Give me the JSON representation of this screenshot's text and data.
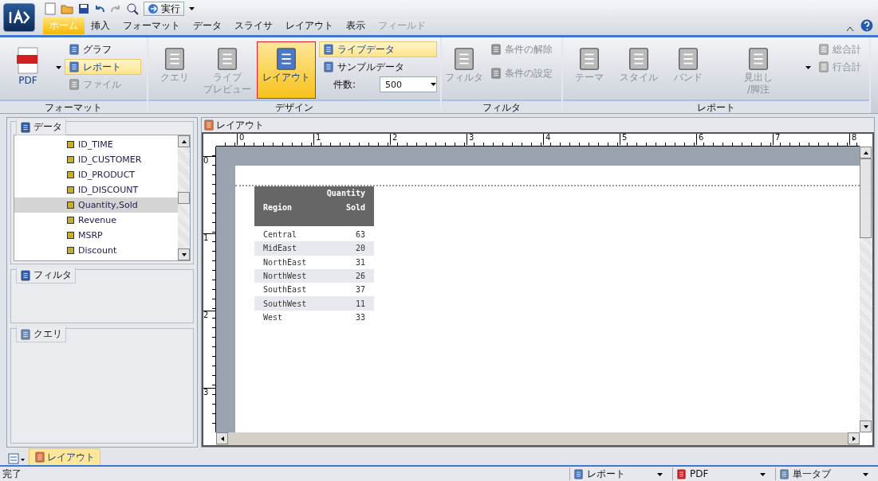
{
  "quick_access": {
    "run_label": "実行"
  },
  "menu_tabs": [
    {
      "label": "ホーム",
      "selected": true,
      "disabled": false
    },
    {
      "label": "挿入",
      "selected": false,
      "disabled": false
    },
    {
      "label": "フォーマット",
      "selected": false,
      "disabled": false
    },
    {
      "label": "データ",
      "selected": false,
      "disabled": false
    },
    {
      "label": "スライサ",
      "selected": false,
      "disabled": false
    },
    {
      "label": "レイアウト",
      "selected": false,
      "disabled": false
    },
    {
      "label": "表示",
      "selected": false,
      "disabled": false
    },
    {
      "label": "フィールド",
      "selected": false,
      "disabled": true
    }
  ],
  "ribbon": {
    "format": {
      "label": "フォーマット",
      "main_label": "PDF",
      "options": [
        {
          "label": "グラフ",
          "selected": false,
          "disabled": false
        },
        {
          "label": "レポート",
          "selected": true,
          "disabled": false
        },
        {
          "label": "ファイル",
          "selected": false,
          "disabled": true
        }
      ]
    },
    "design": {
      "label": "デザイン",
      "buttons": [
        {
          "label": "クエリ",
          "selected": false,
          "disabled": true
        },
        {
          "label": [
            "ライブ",
            "プレビュー"
          ],
          "selected": false,
          "disabled": true
        },
        {
          "label": "レイアウト",
          "selected": true,
          "disabled": false
        }
      ],
      "data_modes": [
        {
          "label": "ライブデータ",
          "selected": true
        },
        {
          "label": "サンプルデータ",
          "selected": false
        }
      ],
      "count_label": "件数:",
      "count_value": "500"
    },
    "filter": {
      "label": "フィルタ",
      "main": {
        "label": "フィルタ",
        "disabled": true
      },
      "actions": [
        {
          "label": "条件の解除",
          "disabled": true
        },
        {
          "label": "条件の設定",
          "disabled": true
        }
      ]
    },
    "report": {
      "label": "レポート",
      "buttons": [
        {
          "label": "テーマ",
          "disabled": true
        },
        {
          "label": "スタイル",
          "disabled": true
        },
        {
          "label": "バンド",
          "disabled": true
        },
        {
          "label": [
            "見出し",
            "/脚注"
          ],
          "disabled": true
        }
      ],
      "totals": [
        {
          "label": "総合計",
          "disabled": true
        },
        {
          "label": "行合計",
          "disabled": true
        }
      ]
    }
  },
  "data_panel": {
    "title": "データ",
    "fields": [
      {
        "label": "ID_TIME",
        "selected": false
      },
      {
        "label": "ID_CUSTOMER",
        "selected": false
      },
      {
        "label": "ID_PRODUCT",
        "selected": false
      },
      {
        "label": "ID_DISCOUNT",
        "selected": false
      },
      {
        "label": "Quantity,Sold",
        "selected": true
      },
      {
        "label": "Revenue",
        "selected": false
      },
      {
        "label": "MSRP",
        "selected": false
      },
      {
        "label": "Discount",
        "selected": false
      }
    ]
  },
  "filter_panel": {
    "title": "フィルタ"
  },
  "query_panel": {
    "title": "クエリ"
  },
  "layout_pane": {
    "title": "レイアウト",
    "ruler_h": [
      "0",
      "1",
      "2",
      "3",
      "4",
      "5",
      "6",
      "7",
      "8"
    ],
    "ruler_v": [
      "0",
      "1",
      "2",
      "3"
    ],
    "report": {
      "columns": [
        "Region",
        "Quantity Sold"
      ],
      "rows": [
        [
          "Central",
          "63"
        ],
        [
          "MidEast",
          "20"
        ],
        [
          "NorthEast",
          "31"
        ],
        [
          "NorthWest",
          "26"
        ],
        [
          "SouthEast",
          "37"
        ],
        [
          "SouthWest",
          "11"
        ],
        [
          "West",
          "33"
        ]
      ]
    }
  },
  "bottom_tabs": [
    {
      "label": "レイアウト",
      "selected": true
    }
  ],
  "status_bar": {
    "text": "完了",
    "dropdowns": [
      {
        "kind": "report",
        "label": "レポート"
      },
      {
        "kind": "pdf",
        "label": "PDF"
      },
      {
        "kind": "tab",
        "label": "単一タブ"
      }
    ]
  }
}
